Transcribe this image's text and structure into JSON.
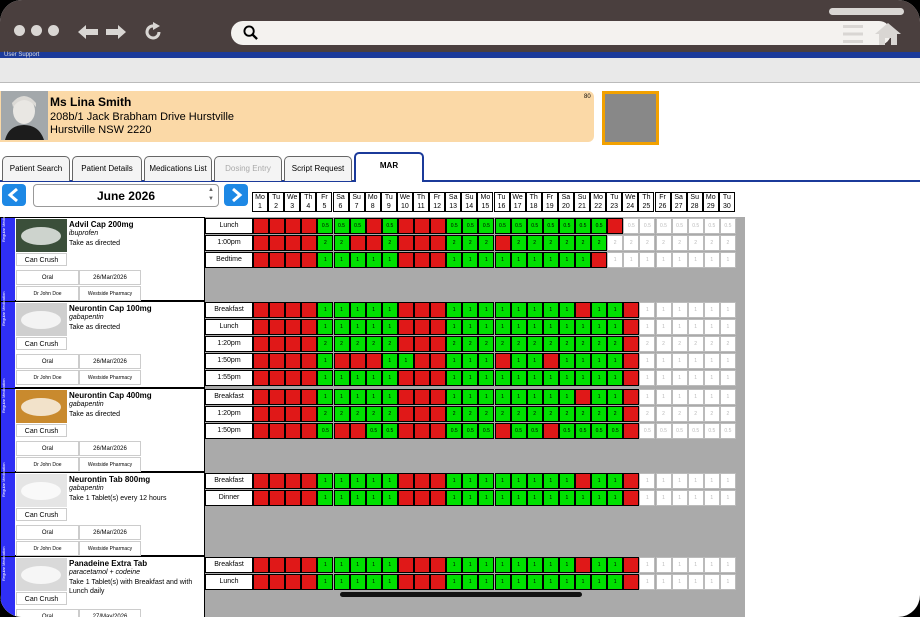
{
  "browser": {
    "url": ""
  },
  "app": {
    "subtitle": "User Support"
  },
  "patient": {
    "name": "Ms Lina Smith",
    "address1": "208b/1 Jack Brabham Drive Hurstville",
    "address2": "Hurstville NSW 2220",
    "number": "80"
  },
  "tabs": [
    "Patient Search",
    "Patient Details",
    "Medications List",
    "Dosing Entry",
    "Script Request",
    "MAR"
  ],
  "tabs_disabled": [
    false,
    false,
    false,
    true,
    false,
    false
  ],
  "active_tab": "MAR",
  "month": "June 2026",
  "days": [
    [
      "Mo",
      "1"
    ],
    [
      "Tu",
      "2"
    ],
    [
      "We",
      "3"
    ],
    [
      "Th",
      "4"
    ],
    [
      "Fr",
      "5"
    ],
    [
      "Sa",
      "6"
    ],
    [
      "Su",
      "7"
    ],
    [
      "Mo",
      "8"
    ],
    [
      "Tu",
      "9"
    ],
    [
      "We",
      "10"
    ],
    [
      "Th",
      "11"
    ],
    [
      "Fr",
      "12"
    ],
    [
      "Sa",
      "13"
    ],
    [
      "Su",
      "14"
    ],
    [
      "Mo",
      "15"
    ],
    [
      "Tu",
      "16"
    ],
    [
      "We",
      "17"
    ],
    [
      "Th",
      "18"
    ],
    [
      "Fr",
      "19"
    ],
    [
      "Sa",
      "20"
    ],
    [
      "Su",
      "21"
    ],
    [
      "Mo",
      "22"
    ],
    [
      "Tu",
      "23"
    ],
    [
      "We",
      "24"
    ],
    [
      "Th",
      "25"
    ],
    [
      "Fr",
      "26"
    ],
    [
      "Sa",
      "27"
    ],
    [
      "Su",
      "28"
    ],
    [
      "Mo",
      "29"
    ],
    [
      "Tu",
      "30"
    ]
  ],
  "colors": {
    "given": "#00e000",
    "missed": "#e01818",
    "future": "#ffffff",
    "accent": "#1b3a9a",
    "side": "#2f2ff5"
  },
  "medications": [
    {
      "name": "Advil Cap 200mg",
      "generic": "ibuprofen",
      "directions": "Take as directed",
      "crush": "Can Crush",
      "route": "Oral",
      "date": "26/Mar/2026",
      "doctor": "Dr John Doe",
      "pharmacy": "Westside Pharmacy",
      "side_label": "Regular Medication",
      "rows": [
        {
          "time": "Lunch",
          "dose": "0.5",
          "pattern": "RRRRGGGRGRRRGGGGGGGGGGRWWWWWWW"
        },
        {
          "time": "1:00pm",
          "dose": "2",
          "pattern": "RRRRGGRRGRRRGGGRGGGGGGWWWWWWWW"
        },
        {
          "time": "Bedtime",
          "dose": "1",
          "pattern": "RRRRGGGGGRRRGGGGGGGGGRWWWWWWWW"
        }
      ]
    },
    {
      "name": "Neurontin Cap 100mg",
      "generic": "gabapentin",
      "directions": "Take as directed",
      "crush": "Can Crush",
      "route": "Oral",
      "date": "26/Mar/2026",
      "doctor": "Dr John Doe",
      "pharmacy": "Westside Pharmacy",
      "side_label": "Regular Medication",
      "rows": [
        {
          "time": "Breakfast",
          "dose": "1",
          "pattern": "RRRRGGGGGRRRGGGGGGGGRGGRWWWWWWW"
        },
        {
          "time": "Lunch",
          "dose": "1",
          "pattern": "RRRRGGGGGRRRGGGGGGGGGGGRWWWWWWW"
        },
        {
          "time": "1:20pm",
          "dose": "2",
          "pattern": "RRRRGGGGGRRRGGGGGGGGGGGRWWWWWWW"
        },
        {
          "time": "1:50pm",
          "dose": "1",
          "pattern": "RRRRGRRRGGRRGGGRGGRGGGGRWWWWWWW"
        },
        {
          "time": "1:55pm",
          "dose": "1",
          "pattern": "RRRRGGGGGRRRGGGGGGGGGGGRWWWWWWW"
        }
      ]
    },
    {
      "name": "Neurontin Cap 400mg",
      "generic": "gabapentin",
      "directions": "Take as directed",
      "crush": "Can Crush",
      "route": "Oral",
      "date": "26/Mar/2026",
      "doctor": "Dr John Doe",
      "pharmacy": "Westside Pharmacy",
      "side_label": "Regular Medication",
      "rows": [
        {
          "time": "Breakfast",
          "dose": "1",
          "pattern": "RRRRGGGGGRRRGGGGGGGGRGGRWWWWWWW"
        },
        {
          "time": "1:20pm",
          "dose": "2",
          "pattern": "RRRRGGGGGRRRGGGGGGGGGGGRWWWWWWW"
        },
        {
          "time": "1:50pm",
          "dose": "0.5",
          "pattern": "RRRRGRRGGRRRGGGRGGRGGGGRWWWWWWW"
        }
      ]
    },
    {
      "name": "Neurontin Tab 800mg",
      "generic": "gabapentin",
      "directions": "Take 1 Tablet(s) every 12 hours",
      "crush": "Can Crush",
      "route": "Oral",
      "date": "26/Mar/2026",
      "doctor": "Dr John Doe",
      "pharmacy": "Westside Pharmacy",
      "side_label": "Regular Medication",
      "rows": [
        {
          "time": "Breakfast",
          "dose": "1",
          "pattern": "RRRRGGGGGRRRGGGGGGGGRGGRWWWWWWW"
        },
        {
          "time": "Dinner",
          "dose": "1",
          "pattern": "RRRRGGGGGRRRGGGGGGGGGGGRWWWWWWW"
        }
      ]
    },
    {
      "name": "Panadeine Extra Tab",
      "generic": "paracetamol + codeine",
      "directions": "Take 1 Tablet(s) with Breakfast and with Lunch daily",
      "crush": "Can Crush",
      "route": "Oral",
      "date": "27/May/2026",
      "doctor": "Dr John Doe",
      "pharmacy": "Westside Pharmacy",
      "side_label": "Regular Medication",
      "rows": [
        {
          "time": "Breakfast",
          "dose": "1",
          "pattern": "RRRRGGGGGRRRGGGGGGGGRGGRWWWWWWW"
        },
        {
          "time": "Lunch",
          "dose": "1",
          "pattern": "RRRRGGGGGRRRGGGGGGGGGGGRWWWWWWW"
        }
      ]
    }
  ]
}
